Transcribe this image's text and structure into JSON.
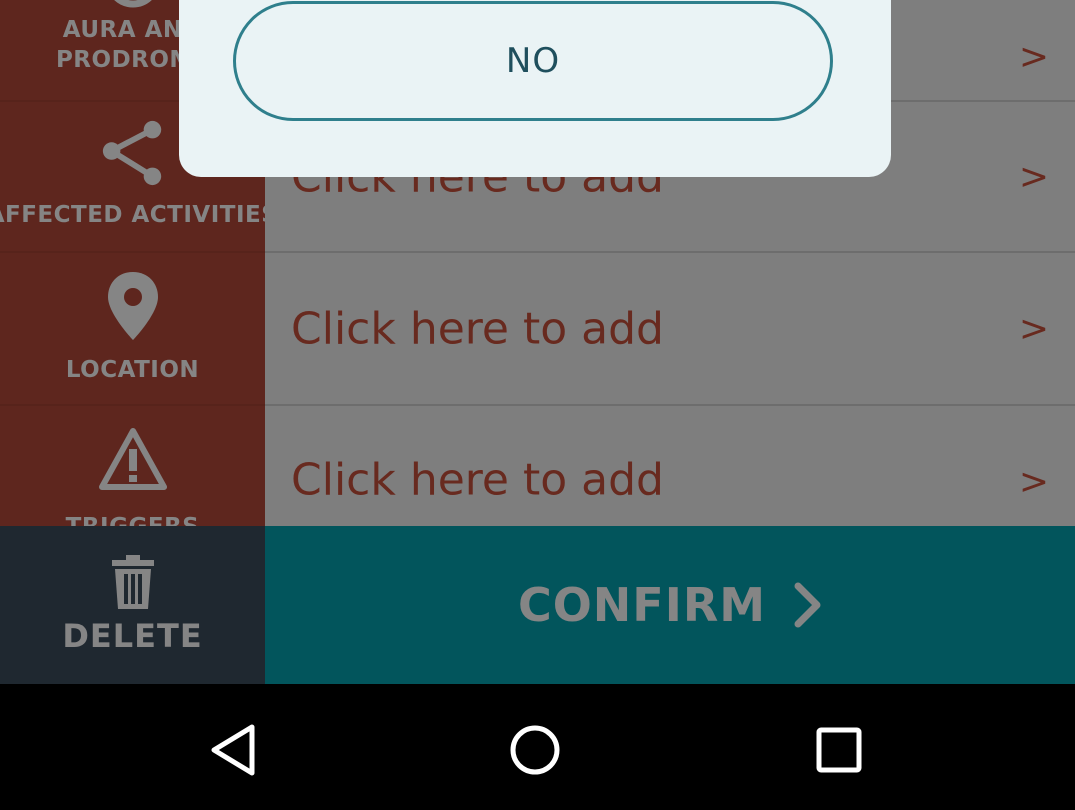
{
  "dialog": {
    "no_label": "NO"
  },
  "rows": [
    {
      "label_line1": "AURA AND",
      "label_line2": "PRODROME",
      "icon": "circle-icon",
      "placeholder": "",
      "arrow": ">"
    },
    {
      "label_line1": "AFFECTED ACTIVITIES",
      "label_line2": "",
      "icon": "share-icon",
      "placeholder": "Click here to add",
      "arrow": ">"
    },
    {
      "label_line1": "LOCATION",
      "label_line2": "",
      "icon": "location-pin-icon",
      "placeholder": "Click here to add",
      "arrow": ">"
    },
    {
      "label_line1": "TRIGGERS",
      "label_line2": "",
      "icon": "warning-triangle-icon",
      "placeholder": "Click here to add",
      "arrow": ">"
    }
  ],
  "actions": {
    "delete_label": "DELETE",
    "confirm_label": "CONFIRM"
  },
  "navbar": {
    "back": "back-icon",
    "home": "home-icon",
    "recents": "recents-icon"
  },
  "colors": {
    "sidebar": "#b54a3b",
    "placeholder": "#c8513d",
    "confirm": "#05a4b0",
    "delete": "#3d4d5c",
    "dialog": "#eaf3f5"
  }
}
